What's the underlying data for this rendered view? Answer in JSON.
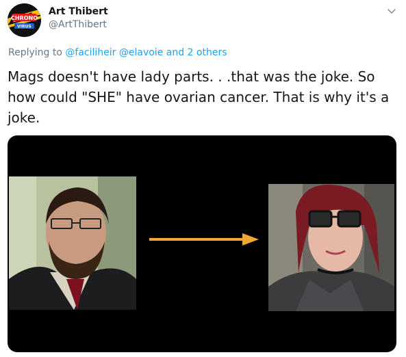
{
  "author": {
    "display_name": "Art Thibert",
    "handle": "@ArtThibert",
    "avatar_text_top": "CHRONO",
    "avatar_text_bottom": "VIRUS"
  },
  "reply": {
    "prefix": "Replying to",
    "mention_1": "@faciliheir",
    "mention_2": "@elavoie",
    "suffix": "and 2 others"
  },
  "tweet": {
    "text": "Mags doesn't have lady parts. . .that was the joke. So how could \"SHE\" have ovarian cancer. That is why it's a joke."
  },
  "icons": {
    "more": "chevron-down-icon",
    "arrow": "right-arrow-icon"
  },
  "colors": {
    "name": "#14171a",
    "secondary": "#657786",
    "link": "#1da1f2",
    "arrow": "#f2a735",
    "media_bg": "#000000"
  }
}
